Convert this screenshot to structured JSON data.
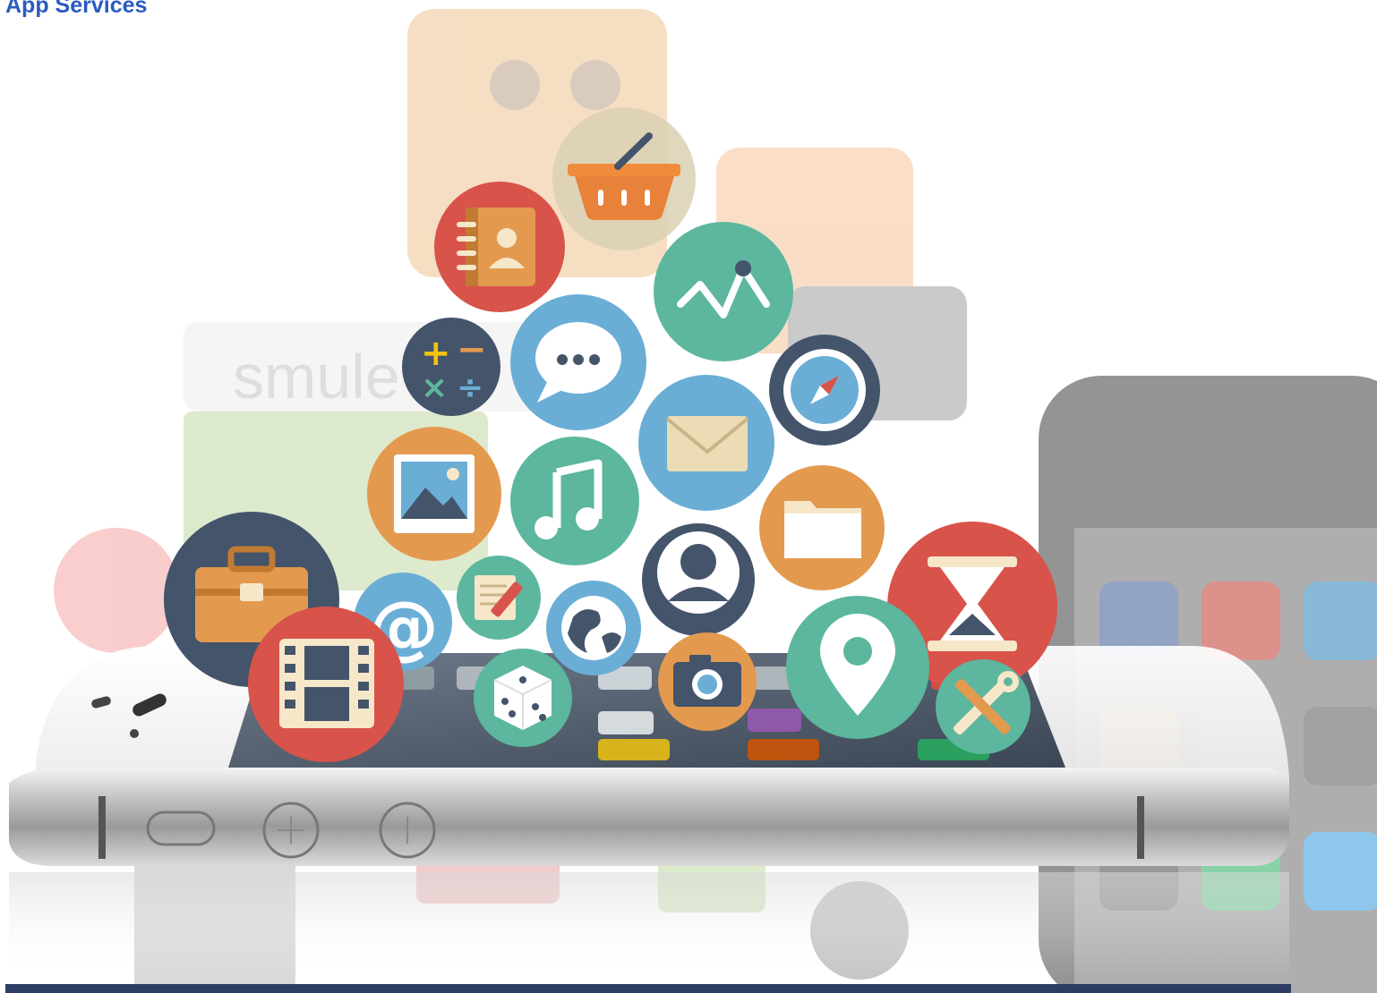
{
  "header": {
    "title": "App Services"
  },
  "hero": {
    "background_app_labels": [
      "smule"
    ],
    "icons": [
      {
        "name": "shopping-basket-icon",
        "color": "#d9d1b4"
      },
      {
        "name": "address-book-icon",
        "color": "#d8534a"
      },
      {
        "name": "analytics-chart-icon",
        "color": "#5cb79e"
      },
      {
        "name": "calculator-icon",
        "color": "#44546b"
      },
      {
        "name": "chat-bubble-icon",
        "color": "#6aaed6"
      },
      {
        "name": "compass-icon",
        "color": "#44546b"
      },
      {
        "name": "mail-icon",
        "color": "#6aaed6"
      },
      {
        "name": "picture-icon",
        "color": "#e39a4f"
      },
      {
        "name": "music-note-icon",
        "color": "#5cb79e"
      },
      {
        "name": "folder-icon",
        "color": "#e39a4f"
      },
      {
        "name": "briefcase-icon",
        "color": "#44546b"
      },
      {
        "name": "user-profile-icon",
        "color": "#44546b"
      },
      {
        "name": "hourglass-icon",
        "color": "#d8534a"
      },
      {
        "name": "at-sign-icon",
        "color": "#6aaed6"
      },
      {
        "name": "notepad-pencil-icon",
        "color": "#5cb79e"
      },
      {
        "name": "globe-icon",
        "color": "#6aaed6"
      },
      {
        "name": "film-strip-icon",
        "color": "#d8534a"
      },
      {
        "name": "dice-icon",
        "color": "#5cb79e"
      },
      {
        "name": "camera-icon",
        "color": "#e39a4f"
      },
      {
        "name": "map-pin-icon",
        "color": "#5cb79e"
      },
      {
        "name": "wrench-screwdriver-icon",
        "color": "#5cb79e"
      }
    ]
  },
  "colors": {
    "title": "#2a5bbf",
    "bottom_bar": "#2e3d63",
    "red": "#d8534a",
    "green": "#5cb79e",
    "blue": "#6aaed6",
    "orange": "#e39a4f",
    "navy": "#44546b"
  }
}
